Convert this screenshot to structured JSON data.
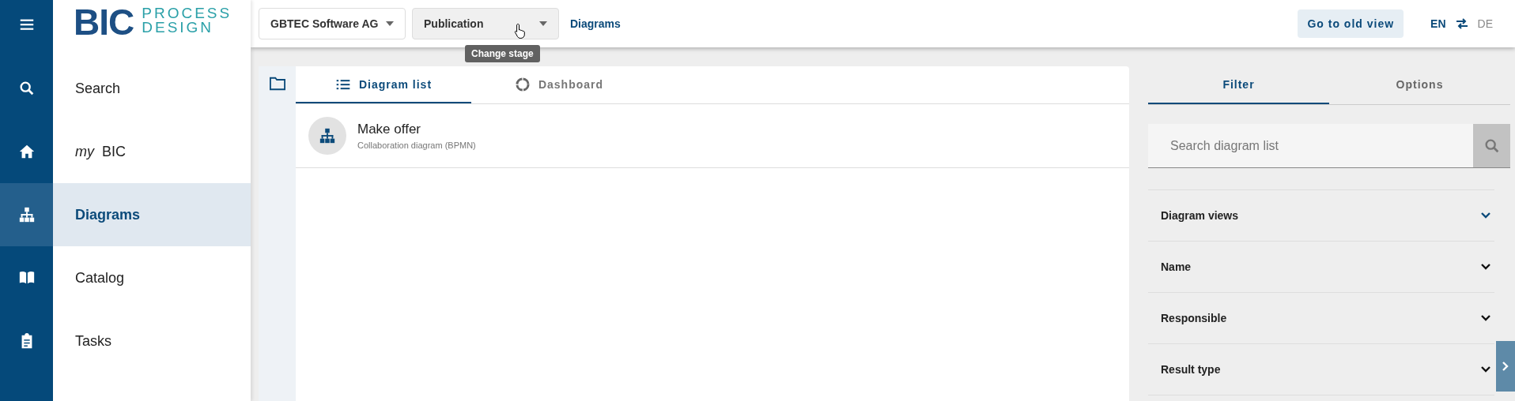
{
  "logo": {
    "main": "BIC",
    "sub_1": "PROCESS",
    "sub_2": "DESIGN"
  },
  "rail": [
    {
      "kind": "menu",
      "selected": false
    },
    {
      "kind": "search",
      "selected": false
    },
    {
      "kind": "home",
      "selected": false
    },
    {
      "kind": "diagram",
      "selected": true
    },
    {
      "kind": "book",
      "selected": false
    },
    {
      "kind": "clipboard",
      "selected": false
    }
  ],
  "nav": [
    {
      "label": "Search",
      "selected": false
    },
    {
      "label": "*my* BIC",
      "selected": false
    },
    {
      "label": "Diagrams",
      "selected": true
    },
    {
      "label": "Catalog",
      "selected": false
    },
    {
      "label": "Tasks",
      "selected": false
    }
  ],
  "toolbar": {
    "dropdowns": [
      {
        "value": "GBTEC Software AG",
        "hovered": false
      },
      {
        "value": "Publication",
        "hovered": true
      }
    ],
    "tooltip": "Change stage",
    "breadcrumb": "Diagrams",
    "old_view_button": "Go to old view",
    "languages": [
      {
        "label": "EN",
        "selected": true
      },
      {
        "label": "DE",
        "selected": false
      }
    ]
  },
  "tabs": [
    {
      "label": "Diagram list",
      "kind": "list",
      "selected": true
    },
    {
      "label": "Dashboard",
      "kind": "ring",
      "selected": false
    }
  ],
  "diagrams": [
    {
      "title": "Make offer",
      "subtitle": "Collaboration diagram (BPMN)"
    }
  ],
  "side_tabs": [
    {
      "label": "Filter",
      "selected": true
    },
    {
      "label": "Options",
      "selected": false
    }
  ],
  "search": {
    "placeholder": "Search diagram list"
  },
  "filters": [
    {
      "label": "Diagram views",
      "highlighted": true
    },
    {
      "label": "Name",
      "highlighted": false
    },
    {
      "label": "Responsible",
      "highlighted": false
    },
    {
      "label": "Result type",
      "highlighted": false
    }
  ]
}
